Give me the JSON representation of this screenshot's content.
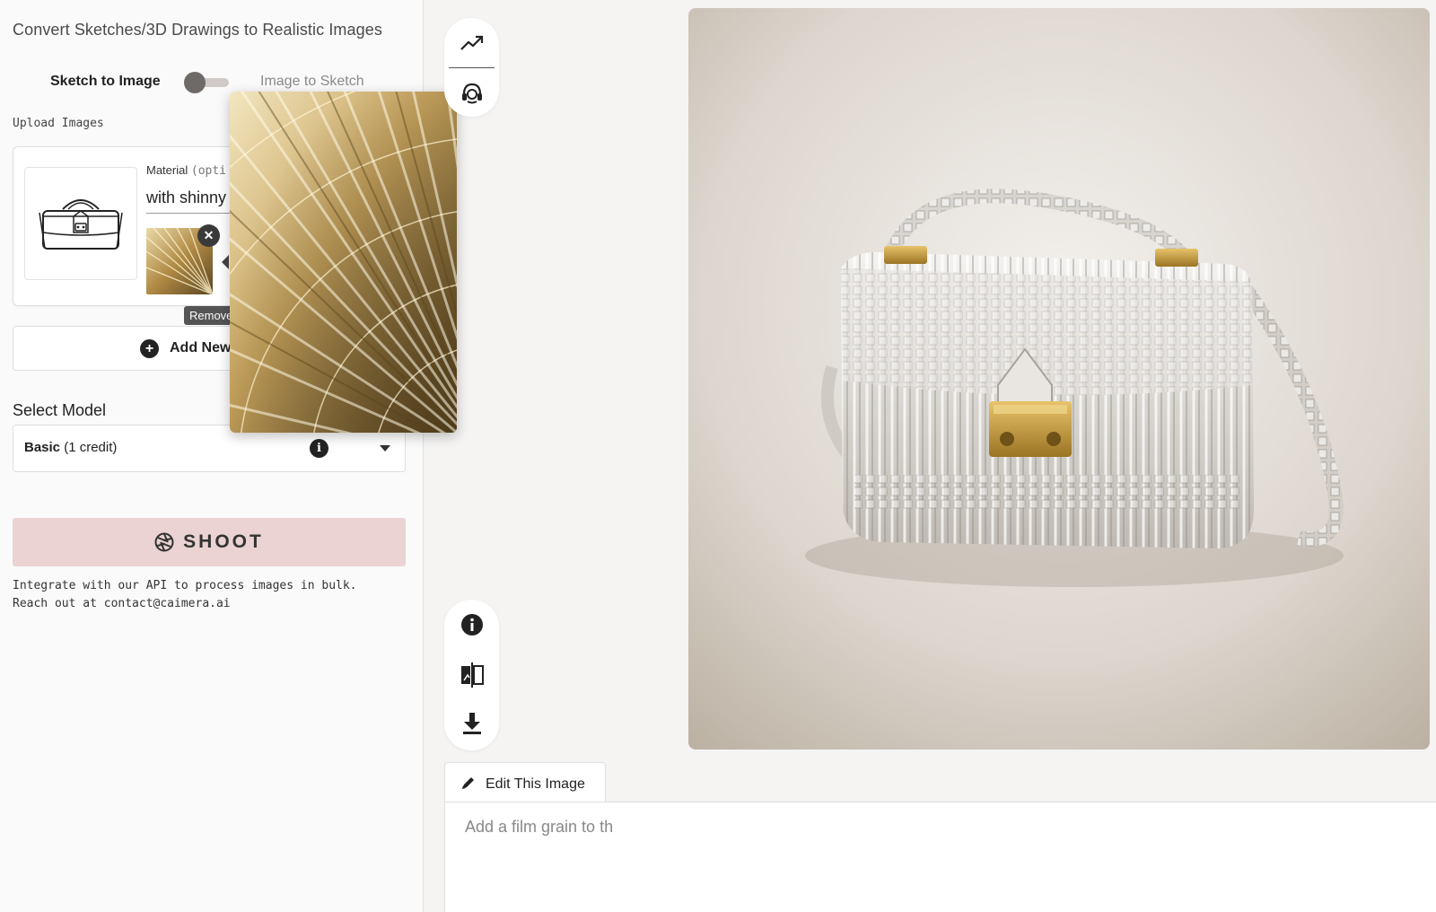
{
  "app": {
    "title": "Convert Sketches/3D Drawings to Realistic Images"
  },
  "mode_toggle": {
    "left_label": "Sketch to Image",
    "right_label": "Image to Sketch",
    "selected": "Sketch to Image"
  },
  "upload": {
    "section_label": "Upload Images",
    "material_label": "Material",
    "material_optional": "(opti",
    "material_value": "with shinny",
    "remove_tooltip": "Remove image",
    "remove_symbol": "✕",
    "add_new_label": "Add New",
    "add_symbol": "+"
  },
  "model": {
    "label": "Select Model",
    "selected_name": "Basic",
    "selected_cost": "(1 credit)",
    "info_symbol": "i"
  },
  "shoot": {
    "label": "SHOOT"
  },
  "api_note": {
    "line1": "Integrate with our API to process images in bulk.",
    "line2": "Reach out at contact@caimera.ai"
  },
  "tools": {
    "top": [
      "trend-icon",
      "support-headset-icon"
    ],
    "bottom": [
      "info-icon",
      "compare-icon",
      "download-icon"
    ]
  },
  "edit": {
    "tab_label": "Edit This Image",
    "placeholder": "Add a film grain to th"
  },
  "colors": {
    "shoot_bg": "#ead3d2",
    "dark": "#222222",
    "toggle_knob": "#6e6a68"
  }
}
